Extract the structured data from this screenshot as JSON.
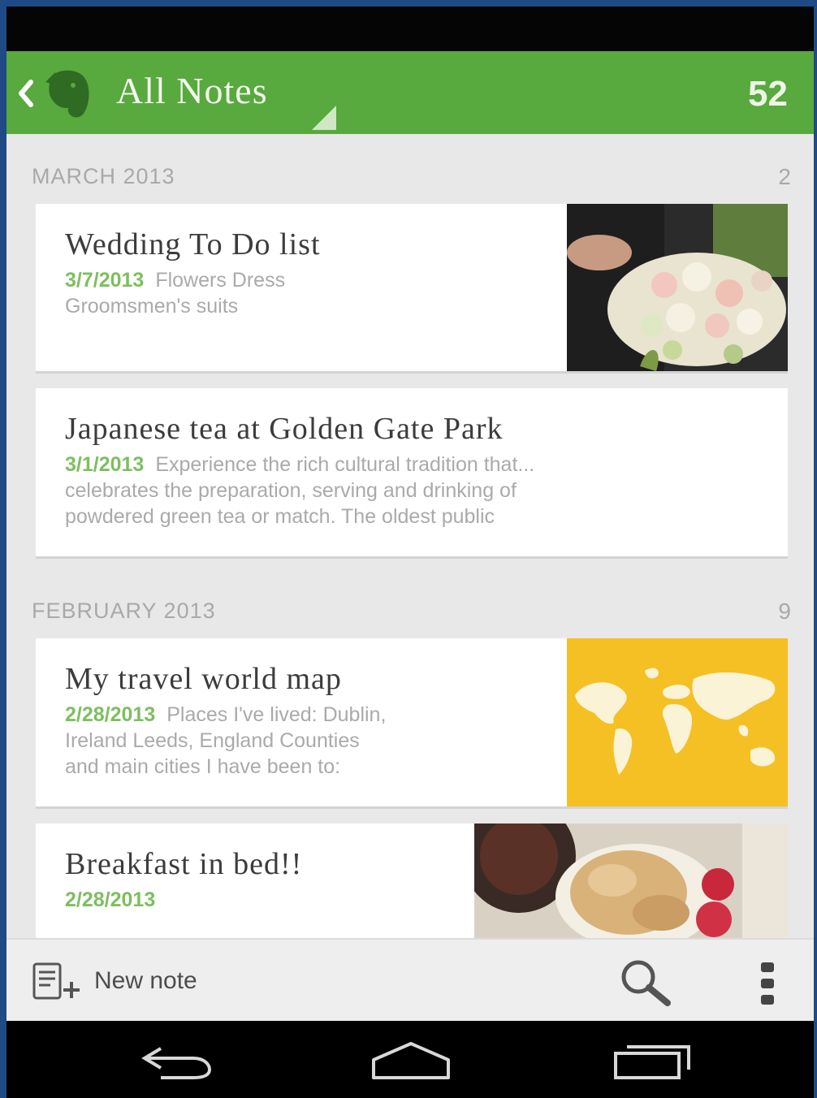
{
  "header": {
    "title": "All Notes",
    "note_count": "52",
    "back_icon": "chevron-left-icon",
    "logo_icon": "evernote-elephant-icon"
  },
  "sections": [
    {
      "label": "MARCH 2013",
      "count": "2",
      "notes": [
        {
          "title": "Wedding To Do list",
          "date": "3/7/2013",
          "snippet_lines": [
            "Flowers   Dress",
            "Groomsmen's suits"
          ],
          "thumbnail": "wedding-bouquet-photo"
        },
        {
          "title": "Japanese tea at Golden Gate Park",
          "date": "3/1/2013",
          "snippet_lines": [
            "Experience the rich cultural tradition that...",
            "celebrates the preparation, serving and drinking of",
            "powdered green tea or match. The oldest public"
          ]
        }
      ]
    },
    {
      "label": "FEBRUARY 2013",
      "count": "9",
      "notes": [
        {
          "title": "My travel world map",
          "date": "2/28/2013",
          "snippet_lines": [
            "Places I've lived:    Dublin,",
            "Ireland   Leeds, England    Counties",
            "and main cities I have been to:"
          ],
          "thumbnail": "world-map-image"
        },
        {
          "title": "Breakfast in bed!!",
          "date": "2/28/2013",
          "snippet_lines": [],
          "thumbnail": "breakfast-photo"
        }
      ]
    }
  ],
  "toolbar": {
    "new_note_label": "New note",
    "new_note_icon": "new-note-icon",
    "search_icon": "search-icon",
    "more_icon": "more-vertical-icon"
  },
  "navigation": {
    "back_icon": "back-arrow-icon",
    "home_icon": "home-icon",
    "recents_icon": "recent-apps-icon"
  },
  "colors": {
    "accent_green": "#58a93e",
    "date_green": "#7cbf5f",
    "map_yellow": "#f5c023",
    "background": "#e8e8e8",
    "frame_blue": "#1f4a86"
  }
}
